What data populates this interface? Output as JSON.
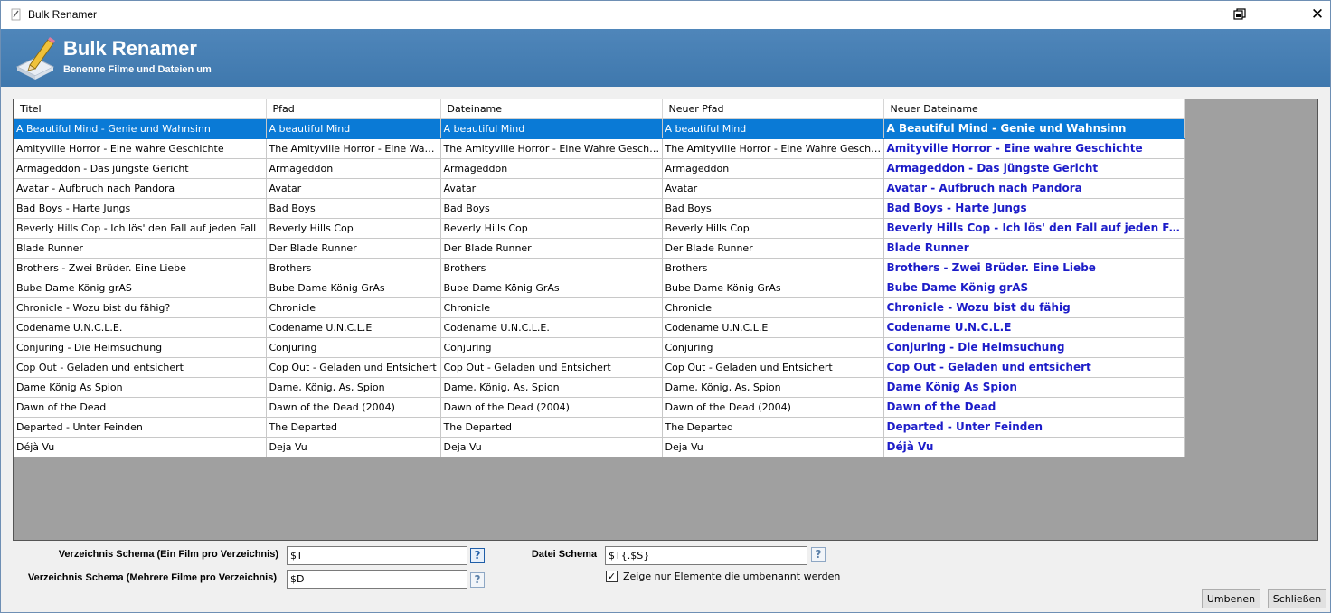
{
  "window": {
    "title": "Bulk Renamer"
  },
  "banner": {
    "title": "Bulk Renamer",
    "subtitle": "Benenne Filme und Dateien um"
  },
  "table": {
    "columns": [
      "Titel",
      "Pfad",
      "Dateiname",
      "Neuer Pfad",
      "Neuer Dateiname"
    ],
    "selected_row": 0,
    "rows": [
      [
        "A Beautiful Mind - Genie und Wahnsinn",
        "A beautiful Mind",
        "A beautiful Mind",
        "A beautiful Mind",
        "A Beautiful Mind - Genie und Wahnsinn"
      ],
      [
        "Amityville Horror - Eine wahre Geschichte",
        "The Amityville Horror -  Eine Wahre Geschichte",
        "The Amityville Horror -  Eine Wahre Geschichte",
        "The Amityville Horror -  Eine Wahre Geschichte",
        "Amityville Horror - Eine wahre Geschichte"
      ],
      [
        "Armageddon - Das jüngste Gericht",
        "Armageddon",
        "Armageddon",
        "Armageddon",
        "Armageddon - Das jüngste Gericht"
      ],
      [
        "Avatar - Aufbruch nach Pandora",
        "Avatar",
        "Avatar",
        "Avatar",
        "Avatar - Aufbruch nach Pandora"
      ],
      [
        "Bad Boys - Harte Jungs",
        "Bad Boys",
        "Bad Boys",
        "Bad Boys",
        "Bad Boys - Harte Jungs"
      ],
      [
        "Beverly Hills Cop - Ich lös' den Fall auf jeden Fall",
        "Beverly Hills Cop",
        "Beverly Hills Cop",
        "Beverly Hills Cop",
        "Beverly Hills Cop - Ich lös' den Fall auf jeden Fall"
      ],
      [
        "Blade Runner",
        "Der Blade Runner",
        "Der Blade Runner",
        "Der Blade Runner",
        "Blade Runner"
      ],
      [
        "Brothers - Zwei Brüder. Eine Liebe",
        "Brothers",
        "Brothers",
        "Brothers",
        "Brothers - Zwei Brüder. Eine Liebe"
      ],
      [
        "Bube Dame König grAS",
        "Bube Dame König GrAs",
        "Bube Dame König GrAs",
        "Bube Dame König GrAs",
        "Bube Dame König grAS"
      ],
      [
        "Chronicle - Wozu bist du fähig?",
        "Chronicle",
        "Chronicle",
        "Chronicle",
        "Chronicle - Wozu bist du fähig"
      ],
      [
        "Codename U.N.C.L.E.",
        "Codename U.N.C.L.E",
        "Codename U.N.C.L.E.",
        "Codename U.N.C.L.E",
        "Codename U.N.C.L.E"
      ],
      [
        "Conjuring - Die Heimsuchung",
        "Conjuring",
        "Conjuring",
        "Conjuring",
        "Conjuring - Die Heimsuchung"
      ],
      [
        "Cop Out - Geladen und entsichert",
        "Cop Out - Geladen und Entsichert",
        "Cop Out - Geladen und Entsichert",
        "Cop Out - Geladen und Entsichert",
        "Cop Out - Geladen und entsichert"
      ],
      [
        "Dame König As Spion",
        "Dame, König, As, Spion",
        "Dame, König, As, Spion",
        "Dame, König, As, Spion",
        "Dame König As Spion"
      ],
      [
        "Dawn of the Dead",
        "Dawn of the Dead (2004)",
        "Dawn of the Dead (2004)",
        "Dawn of the Dead (2004)",
        "Dawn of the Dead"
      ],
      [
        "Departed - Unter Feinden",
        "The Departed",
        "The Departed",
        "The Departed",
        "Departed - Unter Feinden"
      ],
      [
        "Déjà Vu",
        "Deja Vu",
        "Deja Vu",
        "Deja Vu",
        "Déjà Vu"
      ]
    ]
  },
  "form": {
    "dir_schema_single_label": "Verzeichnis Schema (Ein Film pro Verzeichnis)",
    "dir_schema_single_value": "$T",
    "dir_schema_multi_label": "Verzeichnis Schema  (Mehrere Filme pro Verzeichnis)",
    "dir_schema_multi_value": "$D",
    "file_schema_label": "Datei Schema",
    "file_schema_value": "$T{.$S}",
    "help_glyph": "?",
    "only_renamed_label": "Zeige nur Elemente die umbenannt werden",
    "only_renamed_checked": true
  },
  "buttons": {
    "rename": "Umbenen",
    "close": "Schließen"
  },
  "colors": {
    "banner": "#4680b5",
    "selection": "#0a7ad6",
    "new_name_text": "#1c1cc8"
  }
}
